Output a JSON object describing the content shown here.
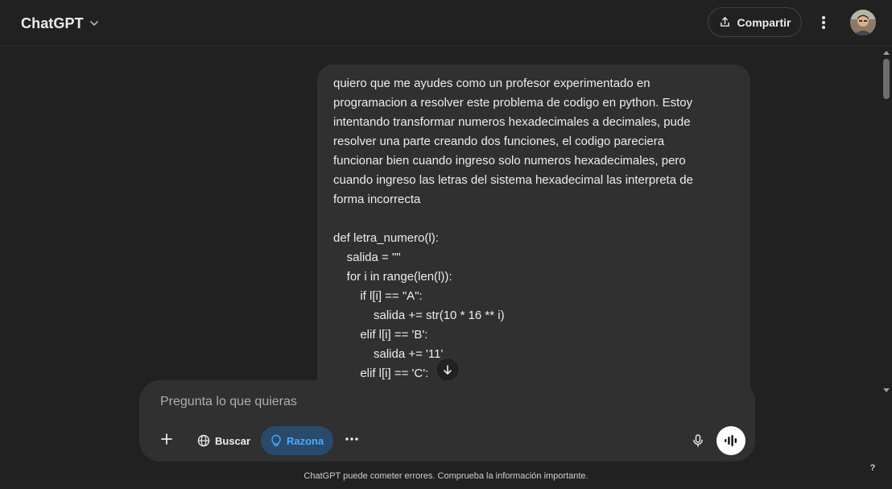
{
  "header": {
    "model_name": "ChatGPT",
    "share_label": "Compartir"
  },
  "message": {
    "lines": [
      "quiero que me ayudes como un profesor experimentado en",
      "programacion a resolver este problema de codigo en python. Estoy",
      "intentando transformar numeros hexadecimales a decimales, pude",
      "resolver una parte creando dos funciones, el codigo pareciera",
      "funcionar bien cuando ingreso solo numeros hexadecimales, pero",
      "cuando ingreso las letras del sistema hexadecimal las interpreta de",
      "forma incorrecta",
      "",
      "def letra_numero(l):",
      "    salida = \"\"",
      "    for i in range(len(l)):",
      "        if l[i] == \"A\":",
      "            salida += str(10 * 16 ** i)",
      "        elif l[i] == 'B':",
      "            salida += '11'",
      "        elif l[i] == 'C':"
    ]
  },
  "composer": {
    "placeholder": "Pregunta lo que quieras",
    "search_label": "Buscar",
    "reason_label": "Razona"
  },
  "footer": {
    "disclaimer": "ChatGPT puede cometer errores. Comprueba la información importante.",
    "help_label": "?"
  },
  "colors": {
    "background": "#212121",
    "bubble": "#303030",
    "accent_blue": "#48aaff"
  },
  "icons": [
    "chevron-down-icon",
    "share-icon",
    "more-vertical-icon",
    "arrow-down-icon",
    "plus-icon",
    "globe-icon",
    "lightbulb-icon",
    "more-horizontal-icon",
    "microphone-icon",
    "voice-waveform-icon"
  ]
}
